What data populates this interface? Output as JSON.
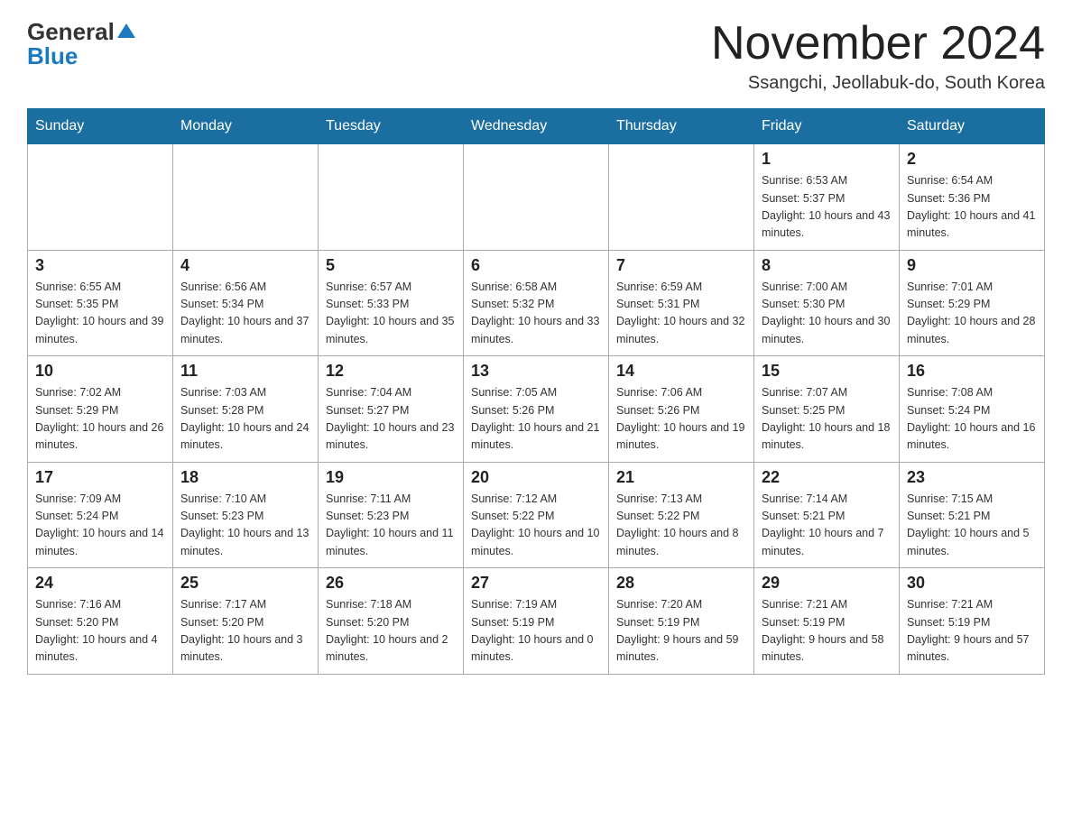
{
  "header": {
    "logo_general": "General",
    "logo_blue": "Blue",
    "title": "November 2024",
    "location": "Ssangchi, Jeollabuk-do, South Korea"
  },
  "days_of_week": [
    "Sunday",
    "Monday",
    "Tuesday",
    "Wednesday",
    "Thursday",
    "Friday",
    "Saturday"
  ],
  "weeks": [
    [
      {
        "day": "",
        "info": ""
      },
      {
        "day": "",
        "info": ""
      },
      {
        "day": "",
        "info": ""
      },
      {
        "day": "",
        "info": ""
      },
      {
        "day": "",
        "info": ""
      },
      {
        "day": "1",
        "info": "Sunrise: 6:53 AM\nSunset: 5:37 PM\nDaylight: 10 hours and 43 minutes."
      },
      {
        "day": "2",
        "info": "Sunrise: 6:54 AM\nSunset: 5:36 PM\nDaylight: 10 hours and 41 minutes."
      }
    ],
    [
      {
        "day": "3",
        "info": "Sunrise: 6:55 AM\nSunset: 5:35 PM\nDaylight: 10 hours and 39 minutes."
      },
      {
        "day": "4",
        "info": "Sunrise: 6:56 AM\nSunset: 5:34 PM\nDaylight: 10 hours and 37 minutes."
      },
      {
        "day": "5",
        "info": "Sunrise: 6:57 AM\nSunset: 5:33 PM\nDaylight: 10 hours and 35 minutes."
      },
      {
        "day": "6",
        "info": "Sunrise: 6:58 AM\nSunset: 5:32 PM\nDaylight: 10 hours and 33 minutes."
      },
      {
        "day": "7",
        "info": "Sunrise: 6:59 AM\nSunset: 5:31 PM\nDaylight: 10 hours and 32 minutes."
      },
      {
        "day": "8",
        "info": "Sunrise: 7:00 AM\nSunset: 5:30 PM\nDaylight: 10 hours and 30 minutes."
      },
      {
        "day": "9",
        "info": "Sunrise: 7:01 AM\nSunset: 5:29 PM\nDaylight: 10 hours and 28 minutes."
      }
    ],
    [
      {
        "day": "10",
        "info": "Sunrise: 7:02 AM\nSunset: 5:29 PM\nDaylight: 10 hours and 26 minutes."
      },
      {
        "day": "11",
        "info": "Sunrise: 7:03 AM\nSunset: 5:28 PM\nDaylight: 10 hours and 24 minutes."
      },
      {
        "day": "12",
        "info": "Sunrise: 7:04 AM\nSunset: 5:27 PM\nDaylight: 10 hours and 23 minutes."
      },
      {
        "day": "13",
        "info": "Sunrise: 7:05 AM\nSunset: 5:26 PM\nDaylight: 10 hours and 21 minutes."
      },
      {
        "day": "14",
        "info": "Sunrise: 7:06 AM\nSunset: 5:26 PM\nDaylight: 10 hours and 19 minutes."
      },
      {
        "day": "15",
        "info": "Sunrise: 7:07 AM\nSunset: 5:25 PM\nDaylight: 10 hours and 18 minutes."
      },
      {
        "day": "16",
        "info": "Sunrise: 7:08 AM\nSunset: 5:24 PM\nDaylight: 10 hours and 16 minutes."
      }
    ],
    [
      {
        "day": "17",
        "info": "Sunrise: 7:09 AM\nSunset: 5:24 PM\nDaylight: 10 hours and 14 minutes."
      },
      {
        "day": "18",
        "info": "Sunrise: 7:10 AM\nSunset: 5:23 PM\nDaylight: 10 hours and 13 minutes."
      },
      {
        "day": "19",
        "info": "Sunrise: 7:11 AM\nSunset: 5:23 PM\nDaylight: 10 hours and 11 minutes."
      },
      {
        "day": "20",
        "info": "Sunrise: 7:12 AM\nSunset: 5:22 PM\nDaylight: 10 hours and 10 minutes."
      },
      {
        "day": "21",
        "info": "Sunrise: 7:13 AM\nSunset: 5:22 PM\nDaylight: 10 hours and 8 minutes."
      },
      {
        "day": "22",
        "info": "Sunrise: 7:14 AM\nSunset: 5:21 PM\nDaylight: 10 hours and 7 minutes."
      },
      {
        "day": "23",
        "info": "Sunrise: 7:15 AM\nSunset: 5:21 PM\nDaylight: 10 hours and 5 minutes."
      }
    ],
    [
      {
        "day": "24",
        "info": "Sunrise: 7:16 AM\nSunset: 5:20 PM\nDaylight: 10 hours and 4 minutes."
      },
      {
        "day": "25",
        "info": "Sunrise: 7:17 AM\nSunset: 5:20 PM\nDaylight: 10 hours and 3 minutes."
      },
      {
        "day": "26",
        "info": "Sunrise: 7:18 AM\nSunset: 5:20 PM\nDaylight: 10 hours and 2 minutes."
      },
      {
        "day": "27",
        "info": "Sunrise: 7:19 AM\nSunset: 5:19 PM\nDaylight: 10 hours and 0 minutes."
      },
      {
        "day": "28",
        "info": "Sunrise: 7:20 AM\nSunset: 5:19 PM\nDaylight: 9 hours and 59 minutes."
      },
      {
        "day": "29",
        "info": "Sunrise: 7:21 AM\nSunset: 5:19 PM\nDaylight: 9 hours and 58 minutes."
      },
      {
        "day": "30",
        "info": "Sunrise: 7:21 AM\nSunset: 5:19 PM\nDaylight: 9 hours and 57 minutes."
      }
    ]
  ]
}
